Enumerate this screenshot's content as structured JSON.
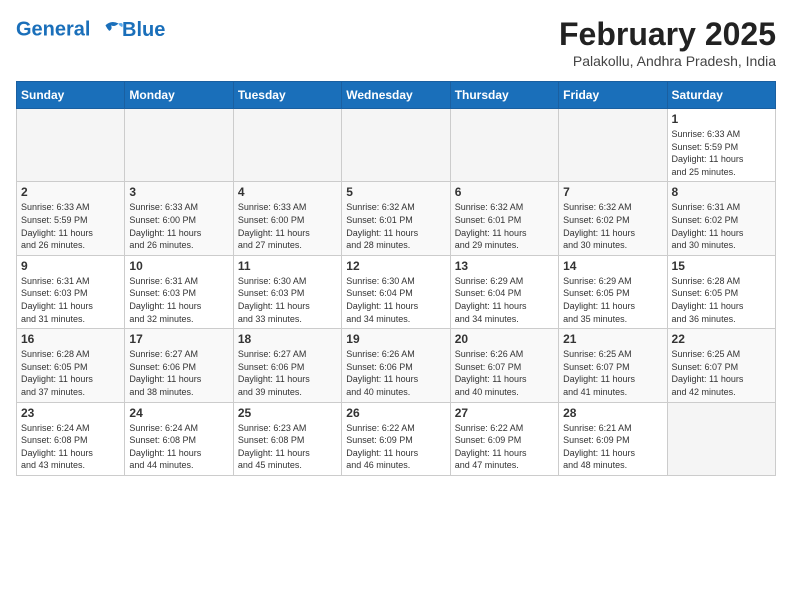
{
  "header": {
    "logo_line1": "General",
    "logo_line2": "Blue",
    "month_year": "February 2025",
    "location": "Palakollu, Andhra Pradesh, India"
  },
  "weekdays": [
    "Sunday",
    "Monday",
    "Tuesday",
    "Wednesday",
    "Thursday",
    "Friday",
    "Saturday"
  ],
  "weeks": [
    [
      {
        "day": "",
        "info": ""
      },
      {
        "day": "",
        "info": ""
      },
      {
        "day": "",
        "info": ""
      },
      {
        "day": "",
        "info": ""
      },
      {
        "day": "",
        "info": ""
      },
      {
        "day": "",
        "info": ""
      },
      {
        "day": "1",
        "info": "Sunrise: 6:33 AM\nSunset: 5:59 PM\nDaylight: 11 hours\nand 25 minutes."
      }
    ],
    [
      {
        "day": "2",
        "info": "Sunrise: 6:33 AM\nSunset: 5:59 PM\nDaylight: 11 hours\nand 26 minutes."
      },
      {
        "day": "3",
        "info": "Sunrise: 6:33 AM\nSunset: 6:00 PM\nDaylight: 11 hours\nand 26 minutes."
      },
      {
        "day": "4",
        "info": "Sunrise: 6:33 AM\nSunset: 6:00 PM\nDaylight: 11 hours\nand 27 minutes."
      },
      {
        "day": "5",
        "info": "Sunrise: 6:32 AM\nSunset: 6:01 PM\nDaylight: 11 hours\nand 28 minutes."
      },
      {
        "day": "6",
        "info": "Sunrise: 6:32 AM\nSunset: 6:01 PM\nDaylight: 11 hours\nand 29 minutes."
      },
      {
        "day": "7",
        "info": "Sunrise: 6:32 AM\nSunset: 6:02 PM\nDaylight: 11 hours\nand 30 minutes."
      },
      {
        "day": "8",
        "info": "Sunrise: 6:31 AM\nSunset: 6:02 PM\nDaylight: 11 hours\nand 30 minutes."
      }
    ],
    [
      {
        "day": "9",
        "info": "Sunrise: 6:31 AM\nSunset: 6:03 PM\nDaylight: 11 hours\nand 31 minutes."
      },
      {
        "day": "10",
        "info": "Sunrise: 6:31 AM\nSunset: 6:03 PM\nDaylight: 11 hours\nand 32 minutes."
      },
      {
        "day": "11",
        "info": "Sunrise: 6:30 AM\nSunset: 6:03 PM\nDaylight: 11 hours\nand 33 minutes."
      },
      {
        "day": "12",
        "info": "Sunrise: 6:30 AM\nSunset: 6:04 PM\nDaylight: 11 hours\nand 34 minutes."
      },
      {
        "day": "13",
        "info": "Sunrise: 6:29 AM\nSunset: 6:04 PM\nDaylight: 11 hours\nand 34 minutes."
      },
      {
        "day": "14",
        "info": "Sunrise: 6:29 AM\nSunset: 6:05 PM\nDaylight: 11 hours\nand 35 minutes."
      },
      {
        "day": "15",
        "info": "Sunrise: 6:28 AM\nSunset: 6:05 PM\nDaylight: 11 hours\nand 36 minutes."
      }
    ],
    [
      {
        "day": "16",
        "info": "Sunrise: 6:28 AM\nSunset: 6:05 PM\nDaylight: 11 hours\nand 37 minutes."
      },
      {
        "day": "17",
        "info": "Sunrise: 6:27 AM\nSunset: 6:06 PM\nDaylight: 11 hours\nand 38 minutes."
      },
      {
        "day": "18",
        "info": "Sunrise: 6:27 AM\nSunset: 6:06 PM\nDaylight: 11 hours\nand 39 minutes."
      },
      {
        "day": "19",
        "info": "Sunrise: 6:26 AM\nSunset: 6:06 PM\nDaylight: 11 hours\nand 40 minutes."
      },
      {
        "day": "20",
        "info": "Sunrise: 6:26 AM\nSunset: 6:07 PM\nDaylight: 11 hours\nand 40 minutes."
      },
      {
        "day": "21",
        "info": "Sunrise: 6:25 AM\nSunset: 6:07 PM\nDaylight: 11 hours\nand 41 minutes."
      },
      {
        "day": "22",
        "info": "Sunrise: 6:25 AM\nSunset: 6:07 PM\nDaylight: 11 hours\nand 42 minutes."
      }
    ],
    [
      {
        "day": "23",
        "info": "Sunrise: 6:24 AM\nSunset: 6:08 PM\nDaylight: 11 hours\nand 43 minutes."
      },
      {
        "day": "24",
        "info": "Sunrise: 6:24 AM\nSunset: 6:08 PM\nDaylight: 11 hours\nand 44 minutes."
      },
      {
        "day": "25",
        "info": "Sunrise: 6:23 AM\nSunset: 6:08 PM\nDaylight: 11 hours\nand 45 minutes."
      },
      {
        "day": "26",
        "info": "Sunrise: 6:22 AM\nSunset: 6:09 PM\nDaylight: 11 hours\nand 46 minutes."
      },
      {
        "day": "27",
        "info": "Sunrise: 6:22 AM\nSunset: 6:09 PM\nDaylight: 11 hours\nand 47 minutes."
      },
      {
        "day": "28",
        "info": "Sunrise: 6:21 AM\nSunset: 6:09 PM\nDaylight: 11 hours\nand 48 minutes."
      },
      {
        "day": "",
        "info": ""
      }
    ]
  ]
}
